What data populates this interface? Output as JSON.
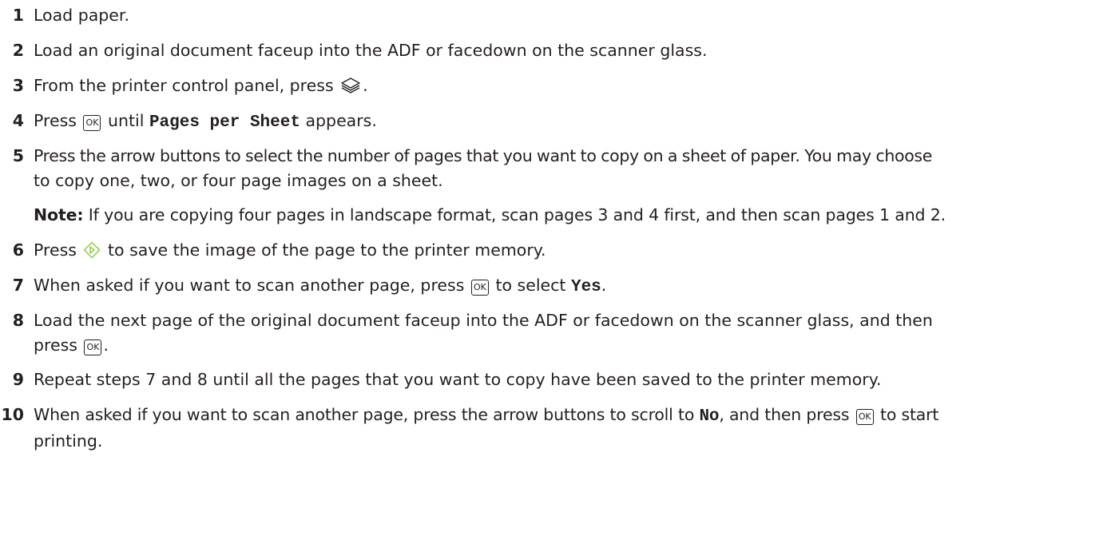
{
  "ok_key_label": "OK",
  "steps": [
    {
      "number": "1",
      "text": "Load paper."
    },
    {
      "number": "2",
      "text": "Load an original document faceup into the ADF or facedown on the scanner glass."
    },
    {
      "number": "3",
      "text_before": "From the printer control panel, press ",
      "icon": "copy-icon",
      "text_after": "."
    },
    {
      "number": "4",
      "text_before": "Press ",
      "text_mid": " until ",
      "code": "Pages per Sheet",
      "text_after": " appears."
    },
    {
      "number": "5",
      "line1": "Press the arrow buttons to select the number of pages that you want to copy on a sheet of paper. You may choose",
      "line2": "to copy one, two, or four page images on a sheet."
    },
    {
      "note_label": "Note:",
      "note_text": " If you are copying four pages in landscape format, scan pages 3 and 4 first, and then scan pages 1 and 2."
    },
    {
      "number": "6",
      "text_before": "Press ",
      "icon": "start-icon",
      "text_after": " to save the image of the page to the printer memory."
    },
    {
      "number": "7",
      "text_before": "When asked if you want to scan another page, press ",
      "text_mid": " to select ",
      "code": "Yes",
      "text_after": "."
    },
    {
      "number": "8",
      "line1": "Load the next page of the original document faceup into the ADF or facedown on the scanner glass, and then",
      "line2_before": "press ",
      "line2_after": "."
    },
    {
      "number": "9",
      "text": "Repeat steps 7 and 8 until all the pages that you want to copy have been saved to the printer memory."
    },
    {
      "number": "10",
      "line1_before": "When asked if you want to scan another page, press the arrow buttons to scroll to ",
      "code": "No",
      "line1_mid": ", and then press ",
      "line1_after": " to start",
      "line2": "printing."
    }
  ]
}
